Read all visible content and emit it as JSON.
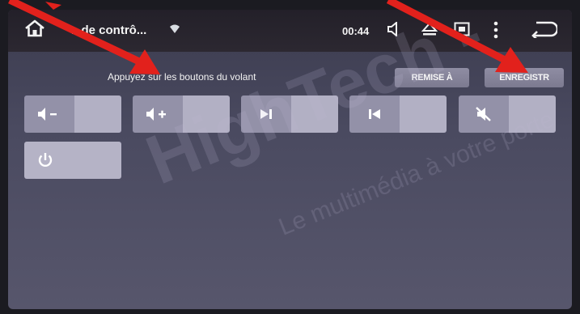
{
  "statusbar": {
    "title": "...de contrô...",
    "clock": "00:44"
  },
  "main": {
    "hint": "Appuyez sur les boutons du volant",
    "reset_label": "REMISE À",
    "save_label": "ENREGISTR"
  },
  "keys": [
    {
      "name": "volume-down",
      "icon": "volume-minus-icon"
    },
    {
      "name": "volume-up",
      "icon": "volume-plus-icon"
    },
    {
      "name": "next-track",
      "icon": "next-track-icon"
    },
    {
      "name": "previous-track",
      "icon": "previous-track-icon"
    },
    {
      "name": "mute",
      "icon": "mute-icon"
    },
    {
      "name": "power",
      "icon": "power-icon"
    }
  ],
  "watermark": {
    "main": "HighTech -",
    "sub": "Le multimédia à votre porte"
  },
  "colors": {
    "annotation_arrow": "#e2211c",
    "statusbar_bg": "#262229",
    "key_icon_bg": "#9391a8",
    "key_slot_bg": "#b2b0c4"
  }
}
